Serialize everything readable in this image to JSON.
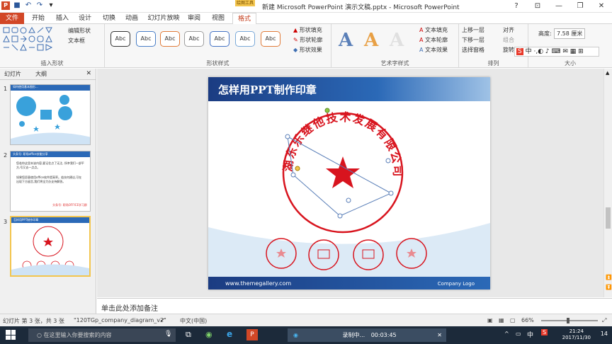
{
  "window": {
    "title": "新建 Microsoft PowerPoint 演示文稿.pptx - Microsoft PowerPoint",
    "context_tab_header": "绘图工具"
  },
  "tabs": [
    "文件",
    "开始",
    "插入",
    "设计",
    "切换",
    "动画",
    "幻灯片放映",
    "审阅",
    "视图",
    "格式"
  ],
  "ribbon": {
    "insert_shapes": {
      "edit_shape": "编辑形状",
      "text_box": "文本框",
      "label": "插入形状"
    },
    "shape_styles": {
      "style_label": "Abc",
      "fill": "形状填充",
      "outline": "形状轮廓",
      "effect": "形状效果",
      "label": "形状样式"
    },
    "wordart": {
      "glyph": "A",
      "text_fill": "文本填充",
      "text_outline": "文本轮廓",
      "text_effect": "文本效果",
      "label": "艺术字样式"
    },
    "arrange": {
      "bring_forward": "上移一层",
      "send_backward": "下移一层",
      "selection_pane": "选择窗格",
      "align": "对齐",
      "group": "组合",
      "rotate": "旋转",
      "label": "排列"
    },
    "size": {
      "height_label": "高度:",
      "height_value": "7.58 厘米",
      "label": "大小"
    }
  },
  "left_pane": {
    "tab_slides": "幻灯片",
    "tab_outline": "大纲",
    "slides": [
      {
        "num": "1",
        "title": "如何使用基本图形..."
      },
      {
        "num": "2",
        "title": "头条号: 职场office技能分享",
        "line1": "您若你这里本该内容,要记住点了无注, 所幸我们一部平方,号又去一点点。",
        "line2": "如果您愿意使用office软件提高率。若技何建议,可在出现下方留言,我们将全力办支持解答。",
        "footer": "头条号: 职场OFFICE学习群"
      },
      {
        "num": "3",
        "title": "怎样用PPT制作印章"
      }
    ]
  },
  "slide": {
    "title": "怎样用PPT制作印章",
    "seal_text": "湖东乐继他技术发展有限公司",
    "url": "www.themegallery.com",
    "company_logo": "Company Logo"
  },
  "notes_placeholder": "单击此处添加备注",
  "status": {
    "slide_info": "幻灯片 第 3 张，共 3 张",
    "theme": "\"120TGp_company_diagram_v2\"",
    "language": "中文(中国)",
    "zoom": "66%"
  },
  "taskbar": {
    "search_placeholder": "在这里输入你要搜索的内容",
    "recording_label": "录制中...",
    "recording_time": "00:03:45",
    "ime": "中",
    "time": "21:24",
    "date": "2017/11/30",
    "notif_count": "14"
  },
  "colors": {
    "file_tab": "#d24726",
    "seal_red": "#d8141e",
    "accent_blue": "#2b69b7"
  }
}
